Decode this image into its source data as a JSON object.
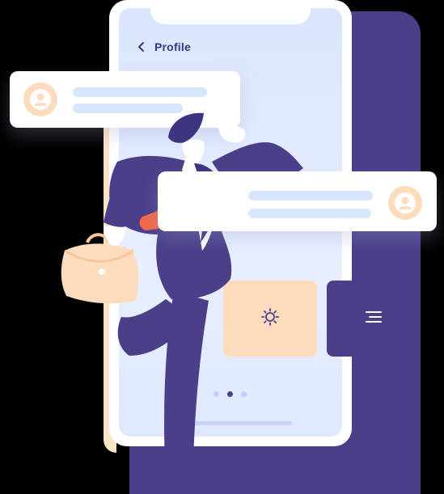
{
  "header": {
    "title": "Profile"
  },
  "pagination": {
    "total": 3,
    "active_index": 1
  },
  "icons": {
    "back": "chevron-left-icon",
    "avatar": "user-avatar-icon",
    "settings": "sun-gear-icon",
    "menu": "hamburger-menu-icon"
  },
  "colors": {
    "primary": "#4b3f8a",
    "accent_peach": "#fddbbd",
    "screen_bg": "#dfe9fe",
    "placeholder_bar": "#d8e6fd",
    "tie": "#f2694a"
  }
}
